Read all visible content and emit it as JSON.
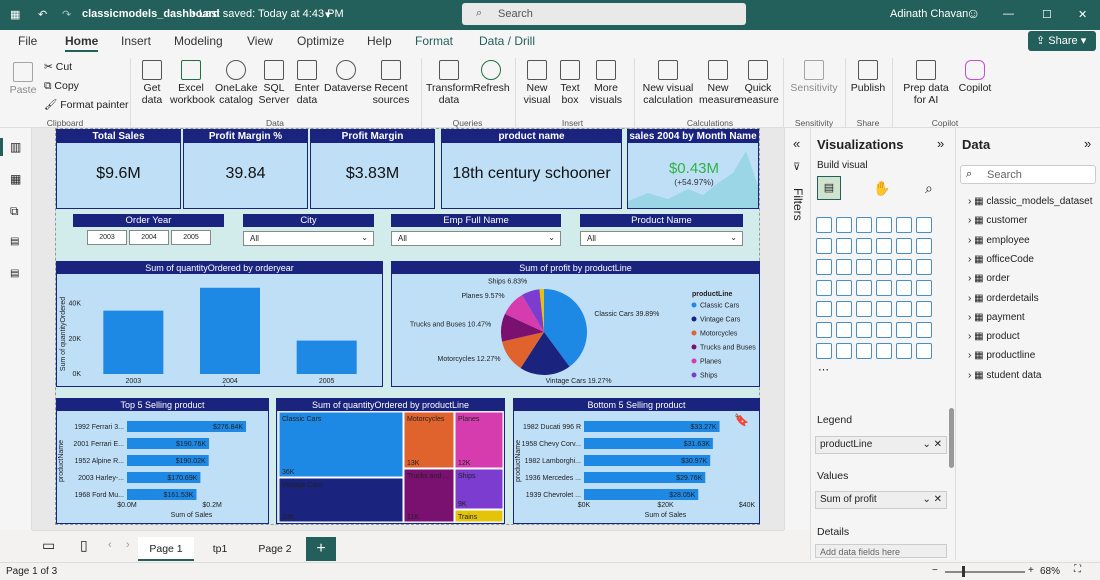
{
  "titlebar": {
    "file": "classicmodels_dashboard",
    "saved": "• Last saved: Today at 4:43 PM",
    "search": "Search",
    "user": "Adinath Chavan"
  },
  "menu": [
    "File",
    "Home",
    "Insert",
    "Modeling",
    "View",
    "Optimize",
    "Help",
    "Format",
    "Data / Drill"
  ],
  "share": "Share",
  "ribbon": {
    "clipboard": {
      "paste": "Paste",
      "cut": "Cut",
      "copy": "Copy",
      "format_painter": "Format painter",
      "group": "Clipboard"
    },
    "data": {
      "items": [
        "Get data",
        "Excel workbook",
        "OneLake catalog",
        "SQL Server",
        "Enter data",
        "Dataverse",
        "Recent sources"
      ],
      "group": "Data"
    },
    "queries": {
      "items": [
        "Transform data",
        "Refresh"
      ],
      "group": "Queries"
    },
    "insert": {
      "items": [
        "New visual",
        "Text box",
        "More visuals"
      ],
      "group": "Insert"
    },
    "calculations": {
      "items": [
        "New visual calculation",
        "New measure",
        "Quick measure"
      ],
      "group": "Calculations"
    },
    "sensitivity": {
      "items": [
        "Sensitivity"
      ],
      "group": "Sensitivity"
    },
    "share": {
      "items": [
        "Publish"
      ],
      "group": "Share"
    },
    "copilot": {
      "items": [
        "Prep data for AI",
        "Copilot"
      ],
      "group": "Copilot"
    }
  },
  "cards": [
    {
      "title": "Total Sales",
      "value": "$9.6M"
    },
    {
      "title": "Profit Margin %",
      "value": "39.84"
    },
    {
      "title": "Profit Margin",
      "value": "$3.83M"
    },
    {
      "title": "product name",
      "value": "18th century schooner"
    }
  ],
  "sales_card": {
    "title": "sales 2004 by Month Name",
    "value": "$0.43M",
    "change": "(+54.97%)"
  },
  "slicers": {
    "order_year": {
      "title": "Order Year",
      "years": [
        "2003",
        "2004",
        "2005"
      ]
    },
    "city": {
      "title": "City",
      "value": "All"
    },
    "emp": {
      "title": "Emp Full Name",
      "value": "All"
    },
    "product": {
      "title": "Product Name",
      "value": "All"
    }
  },
  "charts": {
    "qty_by_year": {
      "title": "Sum of quantityOrdered by orderyear"
    },
    "profit_pie": {
      "title": "Sum of profit by productLine",
      "legend_title": "productLine"
    },
    "top5": {
      "title": "Top 5 Selling product",
      "xlabel": "Sum of Sales",
      "ylabel": "productName"
    },
    "treemap": {
      "title": "Sum of quantityOrdered by productLine"
    },
    "bottom5": {
      "title": "Bottom 5 Selling product",
      "xlabel": "Sum of Sales",
      "ylabel": "productName"
    }
  },
  "chart_data": [
    {
      "type": "bar",
      "title": "Sum of quantityOrdered by orderyear",
      "categories": [
        "2003",
        "2004",
        "2005"
      ],
      "values": [
        36000,
        49000,
        19000
      ],
      "ylabel": "Sum of quantityOrdered",
      "xlabel": "orderyear",
      "ylim": [
        0,
        50000
      ],
      "ticks": [
        "0K",
        "20K",
        "40K"
      ]
    },
    {
      "type": "pie",
      "title": "Sum of profit by productLine",
      "categories": [
        "Classic Cars",
        "Vintage Cars",
        "Motorcycles",
        "Trucks and Buses",
        "Planes",
        "Ships",
        "Trains"
      ],
      "values": [
        39.89,
        19.27,
        12.27,
        10.47,
        9.57,
        6.83,
        1.7
      ],
      "labels": [
        "Classic Cars 39.89%",
        "Vintage Cars 19.27%",
        "Motorcycles 12.27%",
        "Trucks and Buses 10.47%",
        "Planes 9.57%",
        "Ships 6.83%",
        ""
      ],
      "colors": [
        "#1e88e5",
        "#1a237e",
        "#e0622d",
        "#7a1070",
        "#d63cae",
        "#7b3ccf",
        "#e3c40a"
      ]
    },
    {
      "type": "bar",
      "title": "Top 5 Selling product",
      "categories": [
        "1992 Ferrari 3...",
        "2001 Ferrari E...",
        "1952 Alpine R...",
        "2003 Harley-...",
        "1968 Ford Mu..."
      ],
      "values": [
        276.84,
        190.76,
        190.02,
        170.69,
        161.53
      ],
      "labels": [
        "$276.84K",
        "$190.76K",
        "$190.02K",
        "$170.69K",
        "$161.53K"
      ],
      "xticks": [
        "$0.0M",
        "$0.2M"
      ],
      "xlim": [
        0,
        300
      ]
    },
    {
      "type": "treemap",
      "title": "Sum of quantityOrdered by productLine",
      "items": [
        {
          "name": "Classic Cars",
          "label": "36K",
          "color": "#1e88e5"
        },
        {
          "name": "Vintage Cars",
          "label": "23K",
          "color": "#1a237e"
        },
        {
          "name": "Motorcycles",
          "label": "13K",
          "color": "#e0622d"
        },
        {
          "name": "Planes",
          "label": "12K",
          "color": "#d63cae"
        },
        {
          "name": "Trucks and ...",
          "label": "11K",
          "color": "#7a1070"
        },
        {
          "name": "Ships",
          "label": "9K",
          "color": "#7b3ccf"
        },
        {
          "name": "Trains",
          "label": "",
          "color": "#e3c40a"
        }
      ]
    },
    {
      "type": "bar",
      "title": "Bottom 5 Selling product",
      "categories": [
        "1982 Ducati 996 R",
        "1958 Chevy Corv...",
        "1982 Lamborghi...",
        "1936 Mercedes ...",
        "1939 Chevrolet ..."
      ],
      "values": [
        33.27,
        31.63,
        30.97,
        29.76,
        28.05
      ],
      "labels": [
        "$33.27K",
        "$31.63K",
        "$30.97K",
        "$29.76K",
        "$28.05K"
      ],
      "xticks": [
        "$0K",
        "$20K",
        "$40K"
      ],
      "xlim": [
        0,
        40
      ]
    }
  ],
  "filters_label": "Filters",
  "viz": {
    "title": "Visualizations",
    "build": "Build visual",
    "legend": "Legend",
    "legend_field": "productLine",
    "values": "Values",
    "values_field": "Sum of profit",
    "details": "Details",
    "details_hint": "Add data fields here"
  },
  "data_pane": {
    "title": "Data",
    "search": "Search",
    "tables": [
      "classic_models_dataset",
      "customer",
      "employee",
      "officeCode",
      "order",
      "orderdetails",
      "payment",
      "product",
      "productline",
      "student data"
    ]
  },
  "pages": [
    "Page 1",
    "tp1",
    "Page 2"
  ],
  "status": {
    "page": "Page 1 of 3",
    "zoom": "68%"
  }
}
